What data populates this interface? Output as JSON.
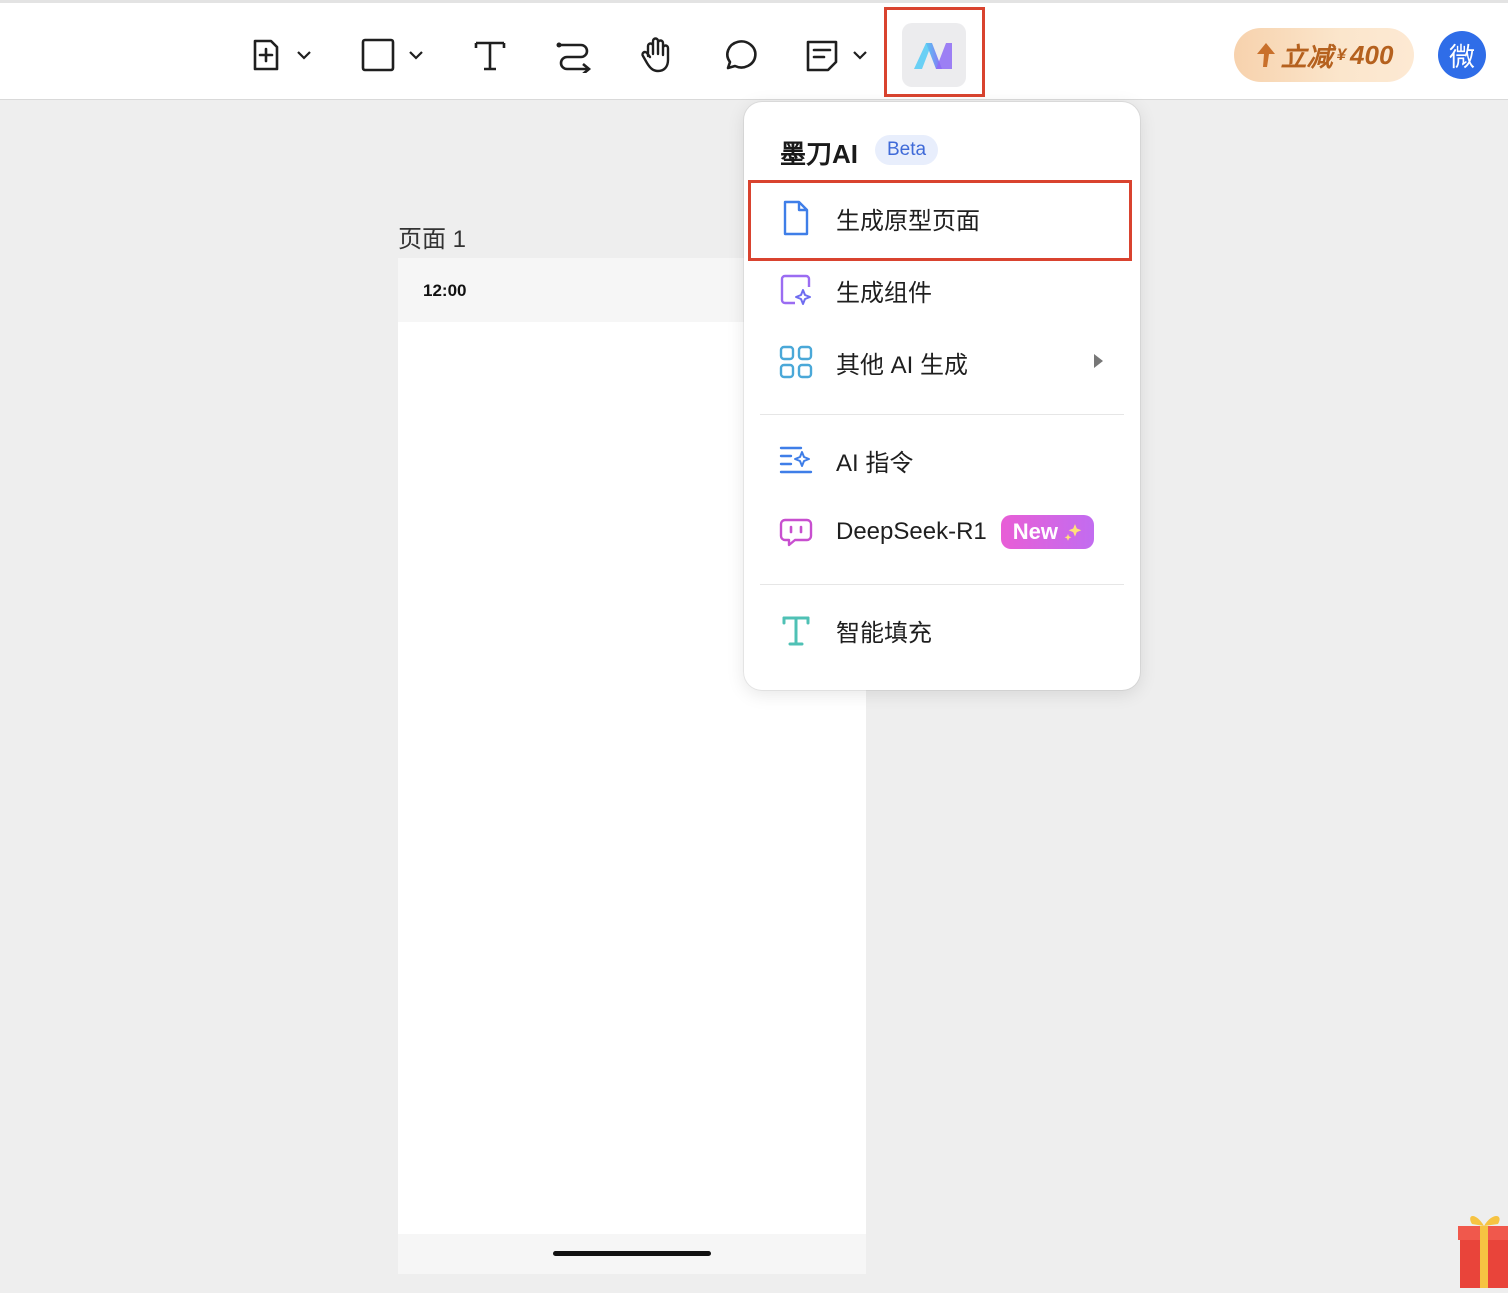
{
  "toolbar": {
    "tools": [
      {
        "name": "add-page-tool",
        "icon": "plus-square-icon",
        "has_dropdown": true
      },
      {
        "name": "shape-tool",
        "icon": "square-icon",
        "has_dropdown": true
      },
      {
        "name": "text-tool",
        "icon": "text-t-icon",
        "has_dropdown": false
      },
      {
        "name": "connector-tool",
        "icon": "connector-icon",
        "has_dropdown": false
      },
      {
        "name": "hand-tool",
        "icon": "hand-icon",
        "has_dropdown": false
      },
      {
        "name": "comment-tool",
        "icon": "comment-bubble-icon",
        "has_dropdown": false
      },
      {
        "name": "note-tool",
        "icon": "note-icon",
        "has_dropdown": true
      }
    ],
    "ai_button_icon": "modao-ai-logo-icon"
  },
  "promo": {
    "arrow_icon": "up-arrow-icon",
    "text": "立减",
    "currency": "¥",
    "amount": "400"
  },
  "avatar": {
    "initial": "微",
    "color": "#2f6de8"
  },
  "canvas": {
    "page_label": "页面 1",
    "status_time": "12:00"
  },
  "ai_menu": {
    "title": "墨刀AI",
    "badge": "Beta",
    "items": [
      {
        "label": "生成原型页面",
        "icon": "document-icon",
        "highlighted": true
      },
      {
        "label": "生成组件",
        "icon": "component-sparkle-icon"
      },
      {
        "label": "其他 AI 生成",
        "icon": "grid-icon",
        "has_submenu": true
      },
      {
        "label": "AI 指令",
        "icon": "ai-command-icon"
      },
      {
        "label": "DeepSeek-R1",
        "icon": "chat-bot-icon",
        "badge": "New",
        "badge_icon": "sparkles-icon"
      },
      {
        "label": "智能填充",
        "icon": "smart-fill-t-icon"
      }
    ]
  },
  "colors": {
    "highlight": "#d9432f",
    "accent": "#2f6de8",
    "ai_purple": "#8b5cf6"
  }
}
